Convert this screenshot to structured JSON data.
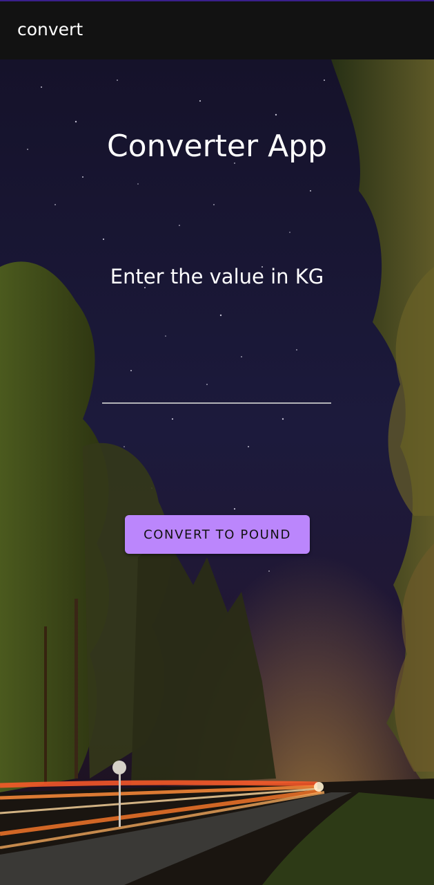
{
  "app_bar": {
    "title": "convert"
  },
  "main": {
    "heading": "Converter App",
    "prompt": "Enter the value in KG",
    "input": {
      "value": "",
      "placeholder": ""
    },
    "convert_button_label": "CONVERT TO POUND"
  },
  "colors": {
    "app_bar_background": "#121212",
    "accent": "#bb86fc",
    "input_underline": "#b4b4b8",
    "text": "#ffffff"
  },
  "background_image": "night-forest-road-long-exposure"
}
